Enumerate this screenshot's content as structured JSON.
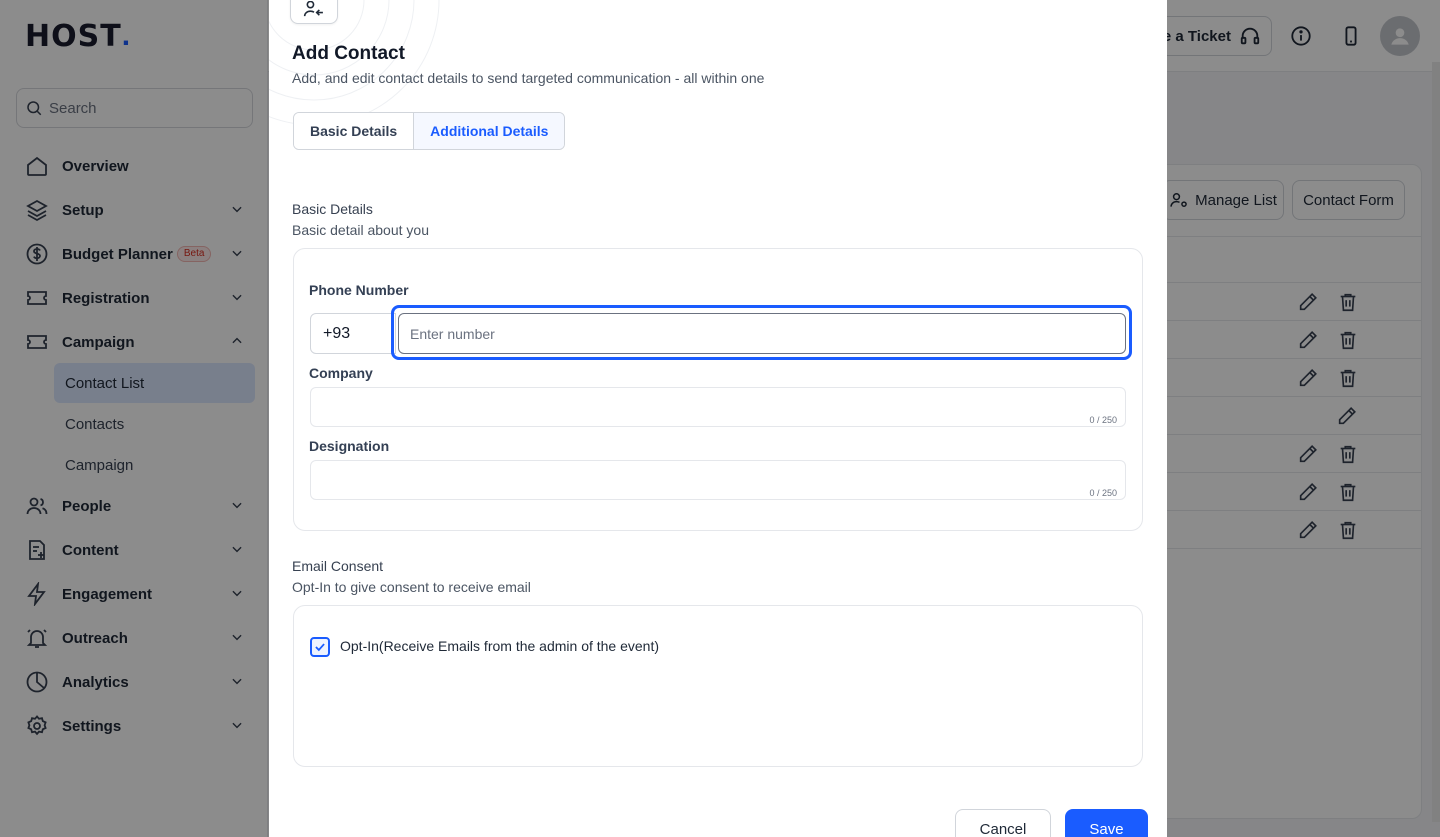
{
  "brand": {
    "logo_text": "HOST",
    "accent": "#1a5cff"
  },
  "sidebar": {
    "search_placeholder": "Search",
    "items": [
      {
        "label": "Overview",
        "icon": "home-icon"
      },
      {
        "label": "Setup",
        "icon": "layers-icon"
      },
      {
        "label": "Budget Planner",
        "icon": "dollar-icon",
        "badge": "Beta"
      },
      {
        "label": "Registration",
        "icon": "ticket-icon"
      },
      {
        "label": "Campaign",
        "icon": "ticket-icon",
        "expanded": true
      },
      {
        "label": "People",
        "icon": "users-icon"
      },
      {
        "label": "Content",
        "icon": "file-plus-icon"
      },
      {
        "label": "Engagement",
        "icon": "lightning-icon"
      },
      {
        "label": "Outreach",
        "icon": "bell-icon"
      },
      {
        "label": "Analytics",
        "icon": "pie-chart-icon"
      },
      {
        "label": "Settings",
        "icon": "gear-icon"
      }
    ],
    "sub_items": [
      {
        "label": "Contact List",
        "active": true
      },
      {
        "label": "Contacts",
        "active": false
      },
      {
        "label": "Campaign",
        "active": false
      }
    ]
  },
  "topbar": {
    "ticket_label": "e a Ticket"
  },
  "panel": {
    "manage_list_label": "Manage List",
    "contact_form_label": "Contact Form"
  },
  "modal": {
    "title": "Add Contact",
    "subtitle": "Add, and edit contact details to send targeted communication - all within one",
    "tabs": [
      {
        "label": "Basic Details",
        "active": false
      },
      {
        "label": "Additional Details",
        "active": true
      }
    ],
    "basic": {
      "title": "Basic Details",
      "description": "Basic detail about you",
      "phone_label": "Phone Number",
      "country_code": "+93",
      "phone_placeholder": "Enter number",
      "company_label": "Company",
      "company_counter": "0 / 250",
      "designation_label": "Designation",
      "designation_counter": "0 / 250"
    },
    "consent": {
      "title": "Email Consent",
      "description": "Opt-In to give consent to receive email",
      "checkbox_label": "Opt-In(Receive Emails from the admin of the event)",
      "checked": true
    },
    "cancel_label": "Cancel",
    "save_label": "Save"
  }
}
